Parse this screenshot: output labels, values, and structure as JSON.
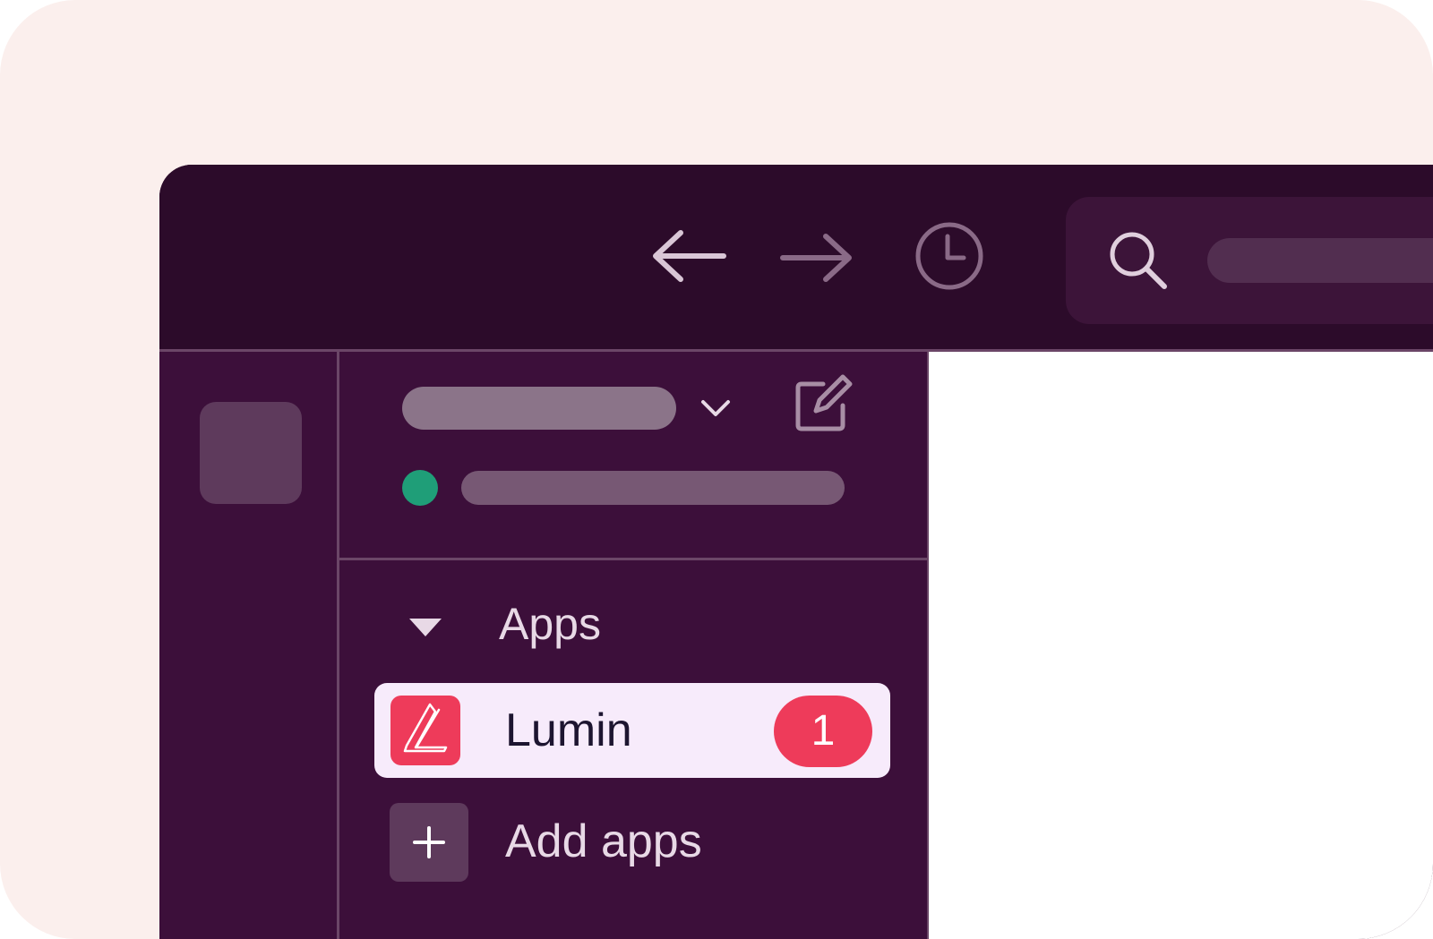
{
  "icons": {
    "back": "arrow-left-icon",
    "forward": "arrow-right-icon",
    "history": "clock-icon",
    "search": "search-icon",
    "workspace_menu": "chevron-down-icon",
    "compose": "compose-icon",
    "section_toggle": "caret-down-icon",
    "add": "plus-icon"
  },
  "sidebar": {
    "section": {
      "label": "Apps"
    },
    "apps": [
      {
        "name": "Lumin",
        "badge": "1",
        "logo": "lumin-logo-icon"
      }
    ],
    "add_apps_label": "Add apps"
  },
  "colors": {
    "backdrop": "#fbefed",
    "topbar": "#2c0b2a",
    "sidebar": "#3c0f3a",
    "accent": "#ee3b5a",
    "status_online": "#1f9e78",
    "selected_item": "#f7ebfb"
  }
}
